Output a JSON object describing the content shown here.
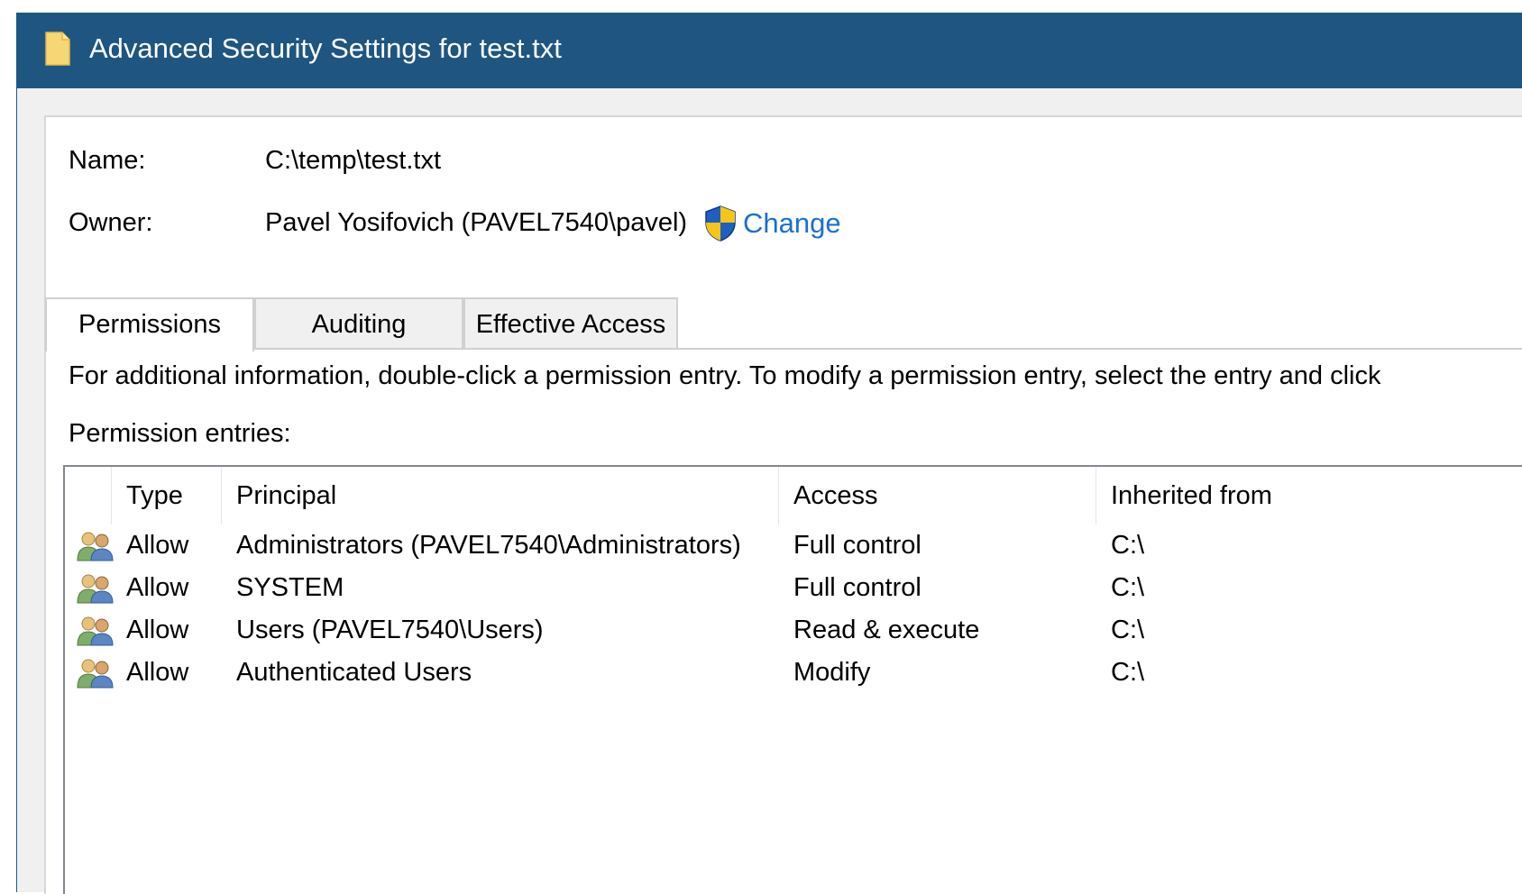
{
  "window": {
    "title": "Advanced Security Settings for test.txt",
    "title_icon": "folder-icon",
    "title_bar_color": "#1e5581"
  },
  "fields": {
    "name_label": "Name:",
    "name_value": "C:\\temp\\test.txt",
    "owner_label": "Owner:",
    "owner_value": "Pavel Yosifovich (PAVEL7540\\pavel)",
    "change_icon": "uac-shield-icon",
    "change_label": "Change",
    "link_color": "#1a6fd1"
  },
  "tabs": [
    {
      "label": "Permissions",
      "active": true
    },
    {
      "label": "Auditing",
      "active": false
    },
    {
      "label": "Effective Access",
      "active": false
    }
  ],
  "info_text": "For additional information, double-click a permission entry. To modify a permission entry, select the entry and click",
  "entries_label": "Permission entries:",
  "table": {
    "columns": [
      "Type",
      "Principal",
      "Access",
      "Inherited from"
    ],
    "row_icon": "users-group-icon",
    "rows": [
      {
        "type": "Allow",
        "principal": "Administrators (PAVEL7540\\Administrators)",
        "access": "Full control",
        "inherited_from": "C:\\"
      },
      {
        "type": "Allow",
        "principal": "SYSTEM",
        "access": "Full control",
        "inherited_from": "C:\\"
      },
      {
        "type": "Allow",
        "principal": "Users (PAVEL7540\\Users)",
        "access": "Read & execute",
        "inherited_from": "C:\\"
      },
      {
        "type": "Allow",
        "principal": "Authenticated Users",
        "access": "Modify",
        "inherited_from": "C:\\"
      }
    ]
  }
}
